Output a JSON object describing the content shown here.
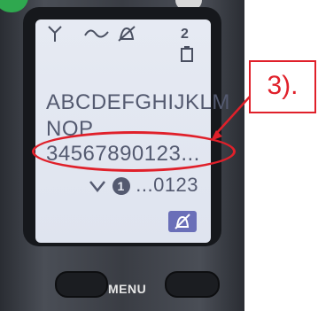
{
  "display": {
    "battery_icon_label": "2",
    "line1": "ABCDEFGHIJKLM",
    "line2": "NOP",
    "line3": "34567890123...",
    "line4_badge": "1",
    "line4_text": "...0123"
  },
  "icons": [
    "antenna-icon",
    "voicemail-icon",
    "ringer-off-icon",
    "battery-icon",
    "missed-call-icon",
    "silent-bell-icon"
  ],
  "phone": {
    "menu_label": "MENU"
  },
  "annotation": {
    "callout_label": "3).",
    "color": "#e0202a"
  }
}
